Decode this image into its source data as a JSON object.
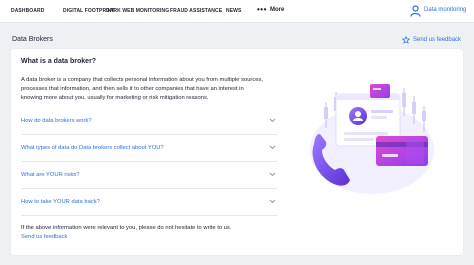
{
  "nav": {
    "items": [
      "DASHBOARD",
      "DIGITAL FOOTPRINT",
      "DARK WEB MONITORING",
      "FRAUD ASSISTANCE",
      "NEWS"
    ],
    "more_dots": "•••",
    "more_label": "More",
    "data_monitoring": "Data monitoring"
  },
  "header": {
    "title": "Data Brokers",
    "feedback": "Send us feedback"
  },
  "card": {
    "title": "What is a data broker?",
    "intro": "A data broker is a company that collects personal information about you from multiple sources, processes that information, and then sells it to other companies that have an interest in knowing more about you, usually for marketing or risk mitigation reasons.",
    "faq": [
      "How do data brokers work?",
      "What types of data do Data brokers collect about YOU?",
      "What are YOUR risks?",
      "How to take YOUR data back?"
    ],
    "footer_note": "If the above information were relevant to you, please do not hesitate to write to us.",
    "footer_link": "Send us feedback"
  },
  "colors": {
    "accent": "#2e6fe0",
    "illustration_purple": "#7a4de8",
    "illustration_magenta": "#d23bc0",
    "background": "#eef0f4"
  },
  "icons": {
    "data_monitoring": "person-icon",
    "feedback": "star-icon",
    "faq": "chevron-down-icon"
  }
}
